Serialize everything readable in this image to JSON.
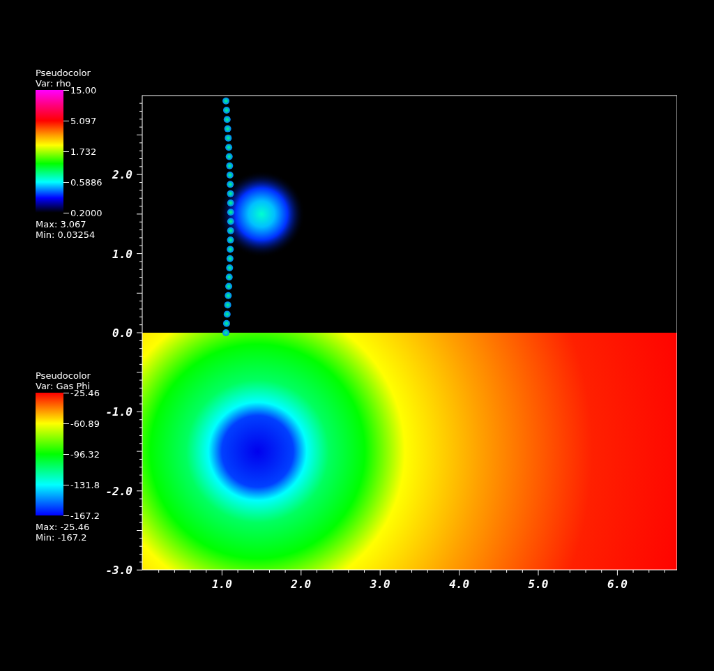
{
  "legends": [
    {
      "title": "Pseudocolor",
      "variable": "Var: rho",
      "ticks": [
        "15.00",
        "5.097",
        "1.732",
        "0.5886",
        "0.2000"
      ],
      "max": "Max:  3.067",
      "min": "Min:  0.03254"
    },
    {
      "title": "Pseudocolor",
      "variable": "Var: Gas Phi",
      "ticks": [
        "-25.46",
        "-60.89",
        "-96.32",
        "-131.8",
        "-167.2"
      ],
      "max": "Max: -25.46",
      "min": "Min: -167.2"
    }
  ],
  "y_axis": {
    "labels": [
      "2.0",
      "1.0",
      "0.0",
      "-1.0",
      "-2.0",
      "-3.0"
    ]
  },
  "x_axis": {
    "labels": [
      "1.0",
      "2.0",
      "3.0",
      "4.0",
      "5.0",
      "6.0"
    ]
  }
}
